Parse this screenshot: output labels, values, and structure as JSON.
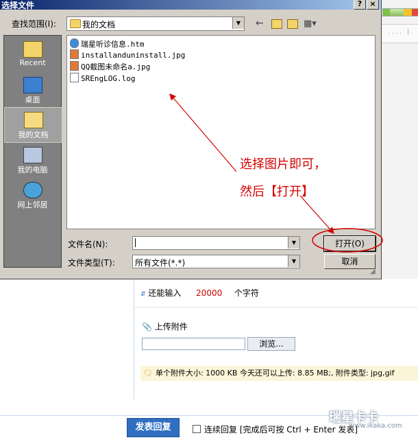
{
  "dialog": {
    "title": "选择文件",
    "help_btn": "?",
    "close_btn": "×",
    "look_in_label": "查找范围(I):",
    "look_in_value": "我的文档",
    "places": [
      {
        "label": "Recent",
        "icon": "recent-folder-icon"
      },
      {
        "label": "桌面",
        "icon": "desktop-icon"
      },
      {
        "label": "我的文档",
        "icon": "my-documents-icon"
      },
      {
        "label": "我的电脑",
        "icon": "my-computer-icon"
      },
      {
        "label": "网上邻居",
        "icon": "network-icon"
      }
    ],
    "files": [
      {
        "name": "瑞星听诊信息.htm",
        "icon": "ie-document-icon"
      },
      {
        "name": "installanduninstall.jpg",
        "icon": "image-file-icon"
      },
      {
        "name": "QQ截图未命名a.jpg",
        "icon": "image-file-icon"
      },
      {
        "name": "SREngLOG.log",
        "icon": "text-file-icon"
      }
    ],
    "filename_label": "文件名(N):",
    "filename_value": "",
    "filetype_label": "文件类型(T):",
    "filetype_value": "所有文件(*.*)",
    "open_btn": "打开(O)",
    "cancel_btn": "取消"
  },
  "annotation": {
    "line1": "选择图片即可，",
    "line2": "然后【打开】",
    "color": "#d40000"
  },
  "page": {
    "chars_prefix": "还能输入",
    "chars_count": "20000",
    "chars_suffix": "个字符",
    "attach_label": "上传附件",
    "browse_btn": "浏览...",
    "info": "单个附件大小: 1000 KB  今天还可以上传: 8.85 MB;,  附件类型: jpg,gif",
    "reply_btn": "发表回复",
    "continuous_reply": "连续回复 [完成后可按 Ctrl + Enter 发表]",
    "watermark": "瑞星卡卡",
    "watermark_url": "www.ikaka.com",
    "accent": "#2f6fc1"
  }
}
